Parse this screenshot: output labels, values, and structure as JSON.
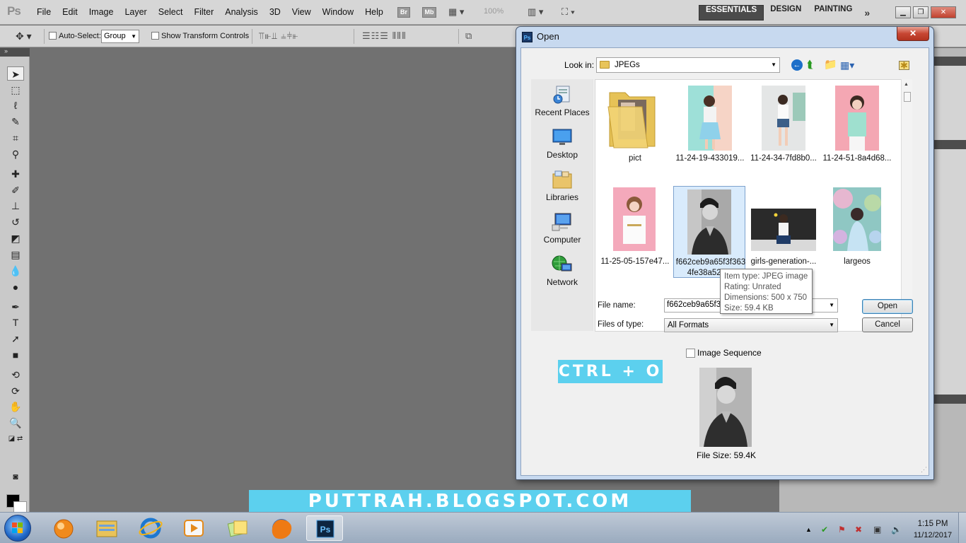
{
  "ps": {
    "logo": "Ps",
    "menu": [
      "File",
      "Edit",
      "Image",
      "Layer",
      "Select",
      "Filter",
      "Analysis",
      "3D",
      "View",
      "Window",
      "Help"
    ],
    "bridge_chip": "Br",
    "minibridge_chip": "Mb",
    "zoom": "100%",
    "workspaces": [
      "ESSENTIALS",
      "DESIGN",
      "PAINTING"
    ],
    "workspace_more": "»"
  },
  "options_bar": {
    "auto_select_label": "Auto-Select:",
    "auto_select_value": "Group",
    "transform_label": "Show Transform Controls"
  },
  "dialog": {
    "title": "Open",
    "close_glyph": "✕",
    "look_in_label": "Look in:",
    "look_in_value": "JPEGs",
    "places": [
      "Recent Places",
      "Desktop",
      "Libraries",
      "Computer",
      "Network"
    ],
    "files": [
      {
        "label": "pict",
        "kind": "folder"
      },
      {
        "label": "11-24-19-433019...",
        "kind": "image"
      },
      {
        "label": "11-24-34-7fd8b0...",
        "kind": "image"
      },
      {
        "label": "11-24-51-8a4d68...",
        "kind": "image"
      },
      {
        "label": "11-25-05-157e47...",
        "kind": "image"
      },
      {
        "label": "f662ceb9a65f3f363 4fe38a52ac7",
        "kind": "image",
        "selected": true
      },
      {
        "label": "girls-generation-...",
        "kind": "image"
      },
      {
        "label": "largeos",
        "kind": "image"
      }
    ],
    "tooltip": {
      "type": "Item type: JPEG image",
      "rating": "Rating: Unrated",
      "dimensions": "Dimensions: 500 x 750",
      "size": "Size: 59.4 KB"
    },
    "file_name_label": "File name:",
    "file_name_value": "f662ceb9a65f3f",
    "files_of_type_label": "Files of type:",
    "files_of_type_value": "All Formats",
    "open_button": "Open",
    "cancel_button": "Cancel",
    "image_sequence_label": "Image Sequence",
    "file_size_text": "File Size: 59.4K"
  },
  "overlays": {
    "shortcut": "CTRL + O",
    "blog": "PUTTRAH.BLOGSPOT.COM"
  },
  "taskbar": {
    "time": "1:15 PM",
    "date": "11/12/2017",
    "apps": [
      "sparkle-app",
      "file-explorer",
      "internet-explorer",
      "media-player",
      "sticky-notes",
      "firefox",
      "photoshop"
    ]
  }
}
